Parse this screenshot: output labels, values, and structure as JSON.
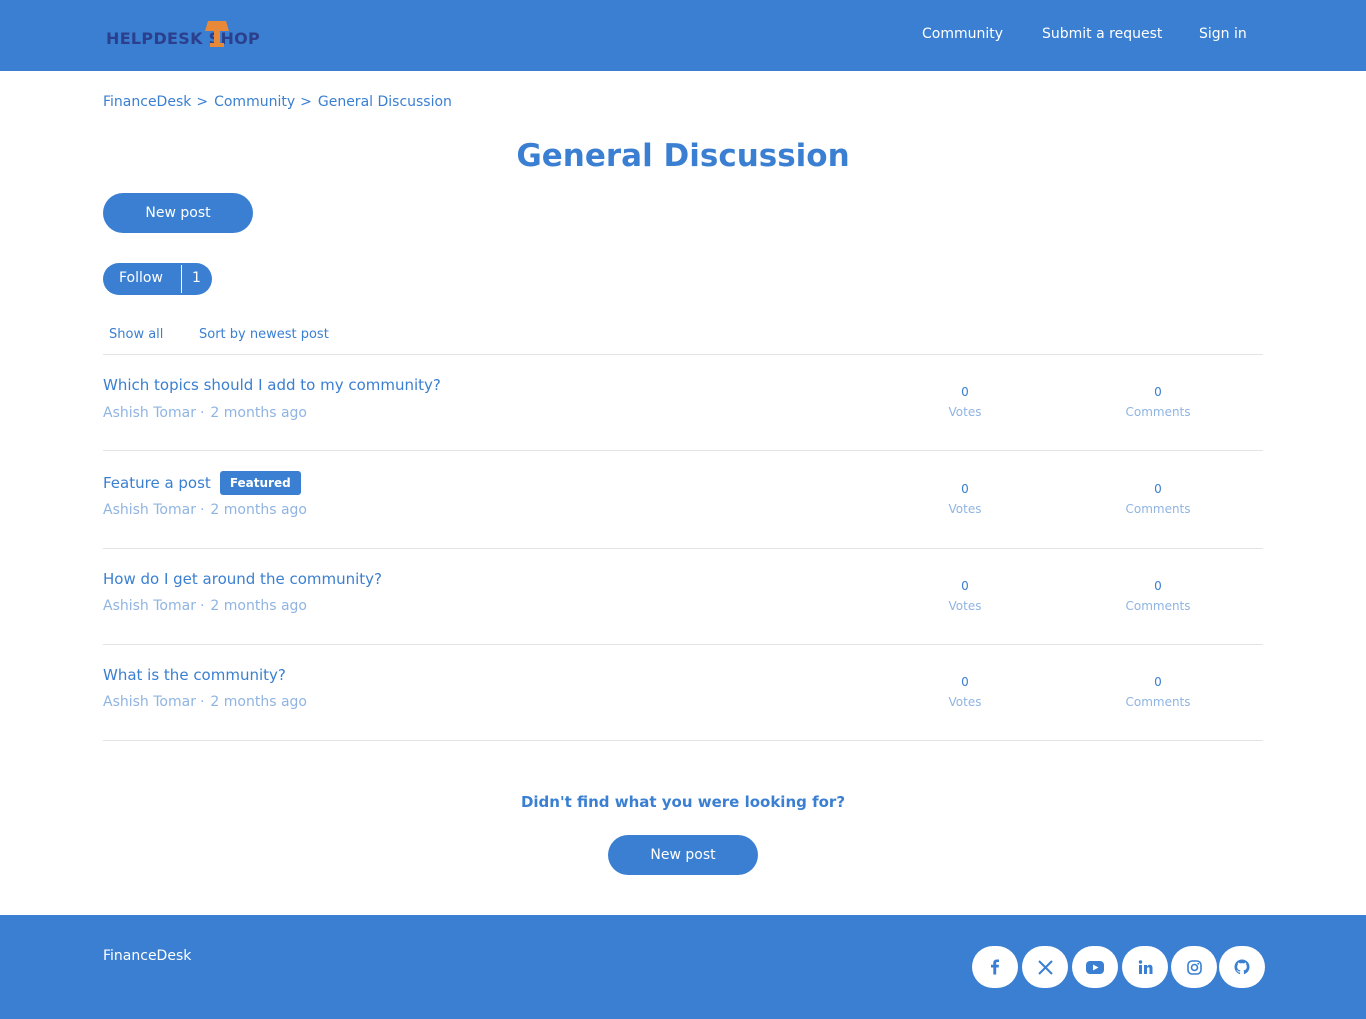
{
  "header": {
    "logo_text": "HELPDESK SHOP",
    "nav": [
      "Community",
      "Submit a request",
      "Sign in"
    ]
  },
  "breadcrumb": [
    "FinanceDesk",
    "Community",
    "General Discussion"
  ],
  "breadcrumb_separator": ">",
  "page_title": "General Discussion",
  "new_post_label": "New post",
  "follow": {
    "label": "Follow",
    "count": "1"
  },
  "filters": {
    "show": "Show all",
    "sort": "Sort by newest post"
  },
  "posts": [
    {
      "title": "Which topics should I add to my community?",
      "badge": "",
      "author": "Ashish Tomar",
      "time": "2 months ago",
      "votes": "0",
      "votes_label": "Votes",
      "comments": "0",
      "comments_label": "Comments"
    },
    {
      "title": "Feature a post",
      "badge": "Featured",
      "author": "Ashish Tomar",
      "time": "2 months ago",
      "votes": "0",
      "votes_label": "Votes",
      "comments": "0",
      "comments_label": "Comments"
    },
    {
      "title": "How do I get around the community?",
      "badge": "",
      "author": "Ashish Tomar",
      "time": "2 months ago",
      "votes": "0",
      "votes_label": "Votes",
      "comments": "0",
      "comments_label": "Comments"
    },
    {
      "title": "What is the community?",
      "badge": "",
      "author": "Ashish Tomar",
      "time": "2 months ago",
      "votes": "0",
      "votes_label": "Votes",
      "comments": "0",
      "comments_label": "Comments"
    }
  ],
  "cta": {
    "text": "Didn't find what you were looking for?",
    "button": "New post"
  },
  "footer": {
    "brand": "FinanceDesk",
    "social_icons": [
      "facebook-icon",
      "x-icon",
      "youtube-icon",
      "linkedin-icon",
      "instagram-icon",
      "github-icon"
    ]
  },
  "colors": {
    "brand_blue": "#3a7fd1",
    "muted_blue": "#8fb4e3",
    "logo_navy": "#2b3f8c",
    "logo_orange": "#e8893a",
    "divider": "#e4e4e4"
  }
}
